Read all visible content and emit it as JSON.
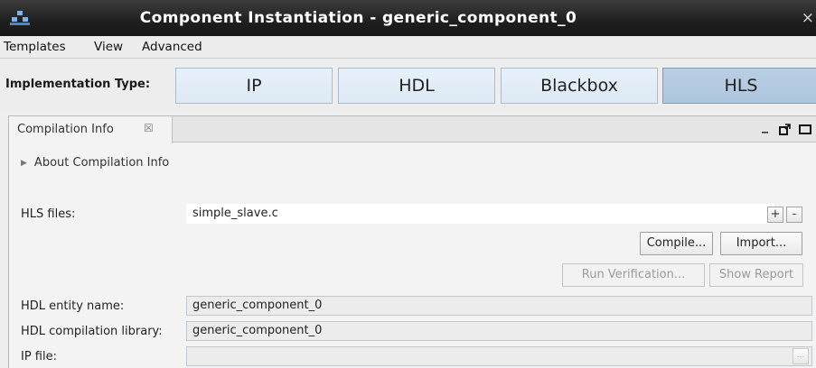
{
  "window": {
    "title": "Component Instantiation - generic_component_0",
    "close_glyph": "×"
  },
  "menu": [
    {
      "label": "Templates"
    },
    {
      "label": "View"
    },
    {
      "label": "Advanced"
    }
  ],
  "implementation": {
    "label": "Implementation Type:",
    "options": [
      "IP",
      "HDL",
      "Blackbox",
      "HLS"
    ],
    "selected": "HLS"
  },
  "panel": {
    "tab_label": "Compilation Info",
    "tab_close_glyph": "☒",
    "about_label": "About Compilation Info",
    "hls_files_label": "HLS files:",
    "hls_files_value": "simple_slave.c",
    "add_glyph": "+",
    "remove_glyph": "-",
    "compile_label": "Compile...",
    "import_label": "Import...",
    "run_verification_label": "Run Verification...",
    "show_report_label": "Show Report",
    "entity_label": "HDL entity name:",
    "entity_value": "generic_component_0",
    "library_label": "HDL compilation library:",
    "library_value": "generic_component_0",
    "ip_file_label": "IP file:",
    "ip_file_value": "",
    "ip_browse_glyph": "..."
  },
  "colors": {
    "accent": "#aec6de",
    "titlebar": "#1f1f1f"
  }
}
